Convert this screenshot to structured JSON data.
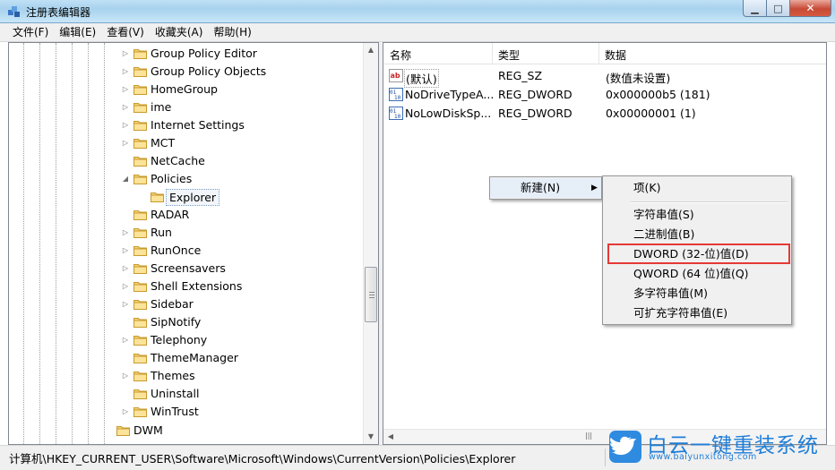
{
  "window": {
    "title": "注册表编辑器",
    "app_icon": "regedit-icon",
    "controls": {
      "minimize": "minimize-icon",
      "maximize": "maximize-icon",
      "close": "close-icon"
    }
  },
  "menubar": [
    "文件(F)",
    "编辑(E)",
    "查看(V)",
    "收藏夹(A)",
    "帮助(H)"
  ],
  "tree": {
    "items": [
      {
        "label": "Group Policy Editor",
        "expander": "▷"
      },
      {
        "label": "Group Policy Objects",
        "expander": "▷"
      },
      {
        "label": "HomeGroup",
        "expander": "▷"
      },
      {
        "label": "ime",
        "expander": "▷"
      },
      {
        "label": "Internet Settings",
        "expander": "▷"
      },
      {
        "label": "MCT",
        "expander": "▷"
      },
      {
        "label": "NetCache",
        "expander": ""
      },
      {
        "label": "Policies",
        "expander": "◢"
      },
      {
        "label": "Explorer",
        "expander": "",
        "selected": true
      },
      {
        "label": "RADAR",
        "expander": ""
      },
      {
        "label": "Run",
        "expander": "▷"
      },
      {
        "label": "RunOnce",
        "expander": "▷"
      },
      {
        "label": "Screensavers",
        "expander": "▷"
      },
      {
        "label": "Shell Extensions",
        "expander": "▷"
      },
      {
        "label": "Sidebar",
        "expander": "▷"
      },
      {
        "label": "SipNotify",
        "expander": ""
      },
      {
        "label": "Telephony",
        "expander": "▷"
      },
      {
        "label": "ThemeManager",
        "expander": ""
      },
      {
        "label": "Themes",
        "expander": "▷"
      },
      {
        "label": "Uninstall",
        "expander": ""
      },
      {
        "label": "WinTrust",
        "expander": "▷"
      },
      {
        "label": "DWM",
        "expander": ""
      }
    ]
  },
  "list": {
    "columns": [
      "名称",
      "类型",
      "数据"
    ],
    "rows": [
      {
        "icon": "string-value-icon",
        "name": "(默认)",
        "type": "REG_SZ",
        "data": "(数值未设置)"
      },
      {
        "icon": "binary-value-icon",
        "name": "NoDriveTypeA...",
        "type": "REG_DWORD",
        "data": "0x000000b5 (181)"
      },
      {
        "icon": "binary-value-icon",
        "name": "NoLowDiskSp...",
        "type": "REG_DWORD",
        "data": "0x00000001 (1)"
      }
    ]
  },
  "context_menu": {
    "new_label": "新建(N)",
    "submenu": [
      "项(K)",
      "字符串值(S)",
      "二进制值(B)",
      "DWORD (32-位)值(D)",
      "QWORD (64 位)值(Q)",
      "多字符串值(M)",
      "可扩充字符串值(E)"
    ],
    "highlighted": "DWORD (32-位)值(D)",
    "highlight_color": "#e53935"
  },
  "statusbar": {
    "path": "计算机\\HKEY_CURRENT_USER\\Software\\Microsoft\\Windows\\CurrentVersion\\Policies\\Explorer"
  },
  "watermark": {
    "title": "白云一键重装系统",
    "url": "www.baiyunxitong.com",
    "logo": "twitter-bird-icon"
  }
}
